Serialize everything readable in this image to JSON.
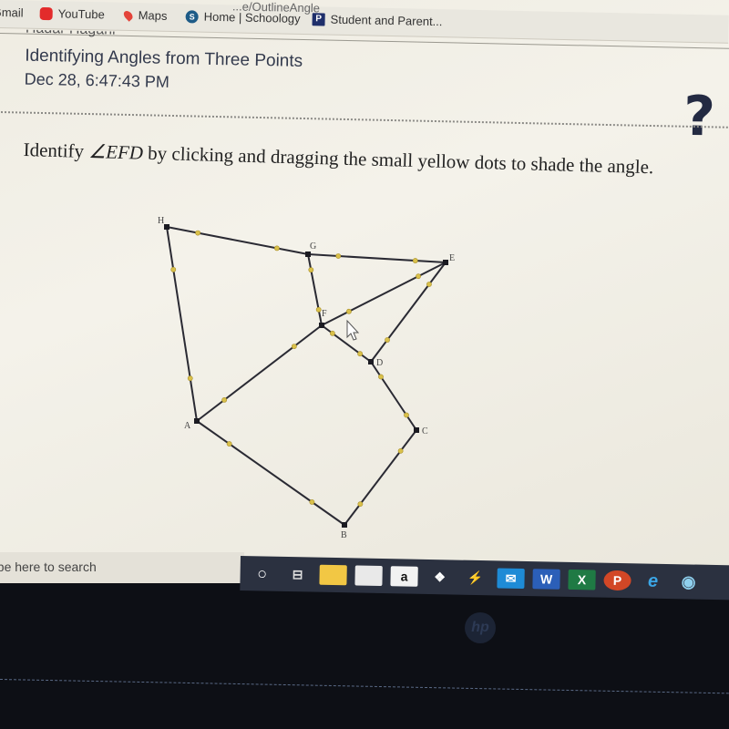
{
  "browser": {
    "url_fragment": "...e/OutlineAngle",
    "bookmarks": [
      {
        "label": "Gmail",
        "icon": "gmail-icon"
      },
      {
        "label": "YouTube",
        "icon": "youtube-icon"
      },
      {
        "label": "Maps",
        "icon": "maps-icon"
      },
      {
        "label": "Home | Schoology",
        "icon": "schoology-icon"
      },
      {
        "label": "Student and Parent...",
        "icon": "powerschool-icon"
      }
    ]
  },
  "header": {
    "student_name": "Hadar Hagani",
    "lesson_title": "Identifying Angles from Three Points",
    "timestamp": "Dec 28, 6:47:43 PM",
    "help_label": "?"
  },
  "question": {
    "prefix": "Identify ",
    "angle_symbol": "∠",
    "angle_name": "EFD",
    "suffix": " by clicking and dragging the small yellow dots to shade the angle."
  },
  "figure": {
    "points": [
      {
        "label": "H"
      },
      {
        "label": "G"
      },
      {
        "label": "E"
      },
      {
        "label": "F"
      },
      {
        "label": "D"
      },
      {
        "label": "A"
      },
      {
        "label": "C"
      },
      {
        "label": "B"
      }
    ],
    "segments": [
      "H-G",
      "G-E",
      "H-A",
      "G-F",
      "F-E",
      "E-D",
      "F-A",
      "F-D",
      "A-B",
      "D-C",
      "C-B"
    ],
    "dot_color": "#d9c04a",
    "point_color": "#1b1b22",
    "line_color": "#2a2a33"
  },
  "taskbar": {
    "search_placeholder": "Type here to search",
    "apps": [
      {
        "name": "cortana",
        "glyph": "○"
      },
      {
        "name": "task-view",
        "glyph": "⊟"
      },
      {
        "name": "file-explorer",
        "glyph": ""
      },
      {
        "name": "store",
        "glyph": ""
      },
      {
        "name": "amazon",
        "glyph": "a"
      },
      {
        "name": "dropbox",
        "glyph": "❖"
      },
      {
        "name": "vs-code",
        "glyph": "⚡"
      },
      {
        "name": "mail",
        "glyph": "✉"
      },
      {
        "name": "word",
        "glyph": "W"
      },
      {
        "name": "excel",
        "glyph": "X"
      },
      {
        "name": "powerpoint",
        "glyph": "P"
      },
      {
        "name": "internet-explorer",
        "glyph": "e"
      },
      {
        "name": "chrome",
        "glyph": "◉"
      }
    ]
  },
  "bezel": {
    "logo": "hp"
  }
}
